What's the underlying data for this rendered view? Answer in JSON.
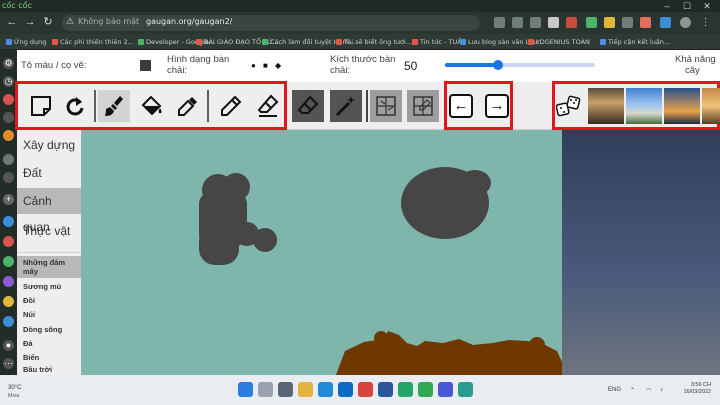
{
  "browser": {
    "brand": "cốc cốc",
    "security_status": "Không bảo mật",
    "url": "gaugan.org/gaugan2/",
    "bookmarks": [
      "Ứng dụng",
      "Các phi thiên thiên 2...",
      "Developer - Google...",
      "BÀI GIÁO ĐẠO TỐ TỨ...",
      "Cách làm đổi tuyệt Hạm...",
      "Tài sẽ biết ông tươi...",
      "Tin tức - TUẦN",
      "Lưu blog sản văn Lưu...",
      "YOGENIUS TOÀN",
      "Tiếp cận kết luận..."
    ]
  },
  "header": {
    "color_label": "Tô màu / cọ vẽ:",
    "shape_label_line1": "Hình dạng bàn",
    "shape_label_line2": "chải:",
    "size_label_line1": "Kích thước bàn",
    "size_label_line2": "chải:",
    "size_value": "50",
    "slider_fraction": 0.35,
    "aux_label_line1": "Khả năng",
    "aux_label_line2": "cây",
    "brush_color": "#3a3a3a"
  },
  "toolbar": {
    "tools": [
      {
        "name": "new-canvas",
        "icon": "page-corner-icon"
      },
      {
        "name": "redo",
        "icon": "redo-icon"
      },
      {
        "name": "brush",
        "icon": "brush-icon",
        "active": true
      },
      {
        "name": "fill",
        "icon": "paint-bucket-icon"
      },
      {
        "name": "eyedropper",
        "icon": "eyedropper-icon"
      },
      {
        "name": "pencil",
        "icon": "pencil-icon"
      },
      {
        "name": "eraser-line",
        "icon": "eraser-line-icon"
      },
      {
        "name": "eraser",
        "icon": "eraser-icon"
      },
      {
        "name": "magic-wand",
        "icon": "magic-wand-icon"
      },
      {
        "name": "segmentation-grid",
        "icon": "grid-icon"
      },
      {
        "name": "sketch-grid",
        "icon": "sketch-grid-icon"
      }
    ],
    "nav_left": "←",
    "nav_right": "→",
    "highlight_color": "#e3141b"
  },
  "categories": {
    "main": [
      {
        "label": "Xây dựng",
        "selected": false
      },
      {
        "label": "Đất",
        "selected": false
      },
      {
        "label": "Cảnh quan",
        "selected": true
      },
      {
        "label": "Thực vật",
        "selected": false
      }
    ],
    "sub": [
      {
        "label": "Những đám mây",
        "selected": true
      },
      {
        "label": "Sương mù",
        "selected": false
      },
      {
        "label": "Đồi",
        "selected": false
      },
      {
        "label": "Núi",
        "selected": false
      },
      {
        "label": "Dòng sông",
        "selected": false
      },
      {
        "label": "Đá",
        "selected": false
      },
      {
        "label": "Biển",
        "selected": false
      },
      {
        "label": "Bầu trời",
        "selected": false
      }
    ]
  },
  "canvas": {
    "background_color": "#7fb6ab",
    "cloud_color": "#464646",
    "ground_color": "#6e3800"
  },
  "taskbar": {
    "temperature": "30°C",
    "weather": "Mưa",
    "time": "3:56 CH",
    "date": "16/03/2022",
    "language": "ENG"
  }
}
